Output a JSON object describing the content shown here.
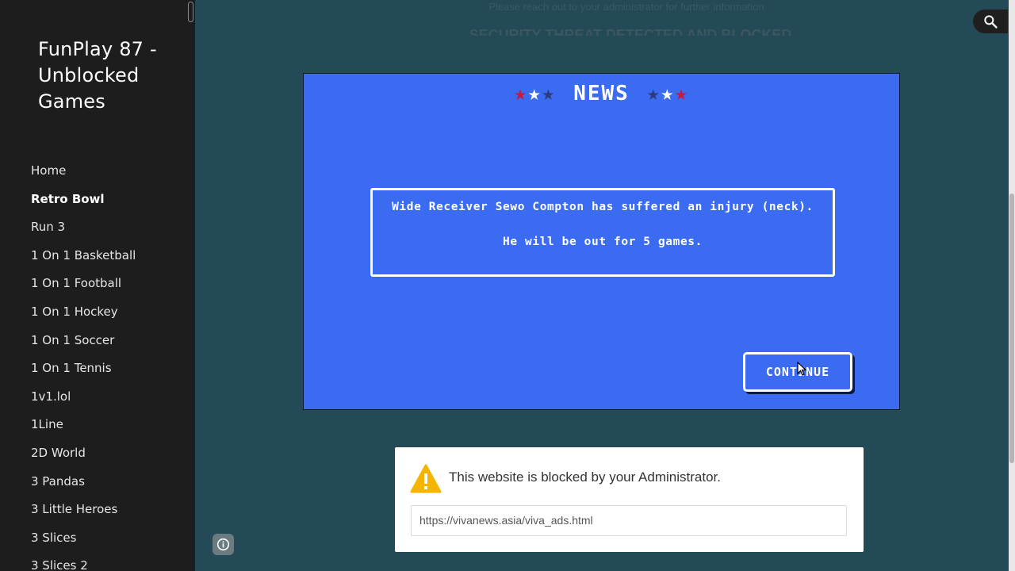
{
  "site": {
    "title": "FunPlay 87 - Unblocked Games"
  },
  "nav": {
    "items": [
      {
        "label": "Home"
      },
      {
        "label": "Retro Bowl",
        "active": true
      },
      {
        "label": "Run 3"
      },
      {
        "label": "1 On 1 Basketball"
      },
      {
        "label": "1 On 1 Football"
      },
      {
        "label": "1 On 1 Hockey"
      },
      {
        "label": "1 On 1 Soccer"
      },
      {
        "label": "1 On 1 Tennis"
      },
      {
        "label": "1v1.lol"
      },
      {
        "label": "1Line"
      },
      {
        "label": "2D World"
      },
      {
        "label": "3 Pandas"
      },
      {
        "label": "3 Little Heroes"
      },
      {
        "label": "3 Slices"
      },
      {
        "label": "3 Slices 2"
      }
    ]
  },
  "background_notice": {
    "line1": "Please reach out to your administrator for further information",
    "line2": "SECURITY THREAT DETECTED AND BLOCKED"
  },
  "game": {
    "header": "NEWS",
    "message_line1": "Wide Receiver Sewo Compton has suffered an injury (neck).",
    "message_line2": "He will be out for 5 games.",
    "continue_label": "CONTINUE",
    "background_color": "#3b6bf1"
  },
  "blocked": {
    "message": "This website is blocked by your Administrator.",
    "url": "https://vivanews.asia/viva_ads.html",
    "icon": "warning-icon",
    "icon_color": "#f4b400"
  },
  "icons": {
    "search": "search-icon",
    "info": "info-icon"
  },
  "colors": {
    "page_background": "#244a57",
    "sidebar_background": "#1d1d1d",
    "star_red": "#c51a3e",
    "star_navy": "#2d3a7c"
  }
}
